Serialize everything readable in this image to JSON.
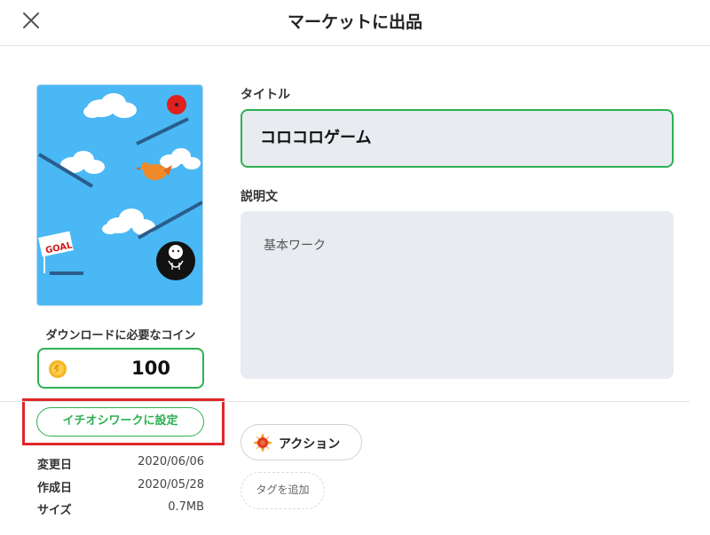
{
  "header": {
    "title": "マーケットに出品",
    "close_icon": "close-icon"
  },
  "work": {
    "thumbnail_icon": "game-thumbnail",
    "goal_sign": "GOAL",
    "coin_label": "ダウンロードに必要なコイン",
    "coin_icon": "coin-icon",
    "coin_value": "100",
    "featured_button": "イチオシワークに設定",
    "meta": [
      {
        "label": "変更日",
        "value": "2020/06/06"
      },
      {
        "label": "作成日",
        "value": "2020/05/28"
      },
      {
        "label": "サイズ",
        "value": "0.7MB"
      }
    ]
  },
  "form": {
    "title_label": "タイトル",
    "title_value": "コロコロゲーム",
    "description_label": "説明文",
    "description_value": "基本ワーク"
  },
  "tags": {
    "items": [
      {
        "label": "アクション",
        "icon": "sun-icon"
      }
    ],
    "add_label": "タグを追加"
  },
  "colors": {
    "accent_green": "#2db052",
    "highlight_red": "#e0262a",
    "input_bg": "#e8ebf0",
    "thumbnail_sky": "#4ab8f4"
  }
}
